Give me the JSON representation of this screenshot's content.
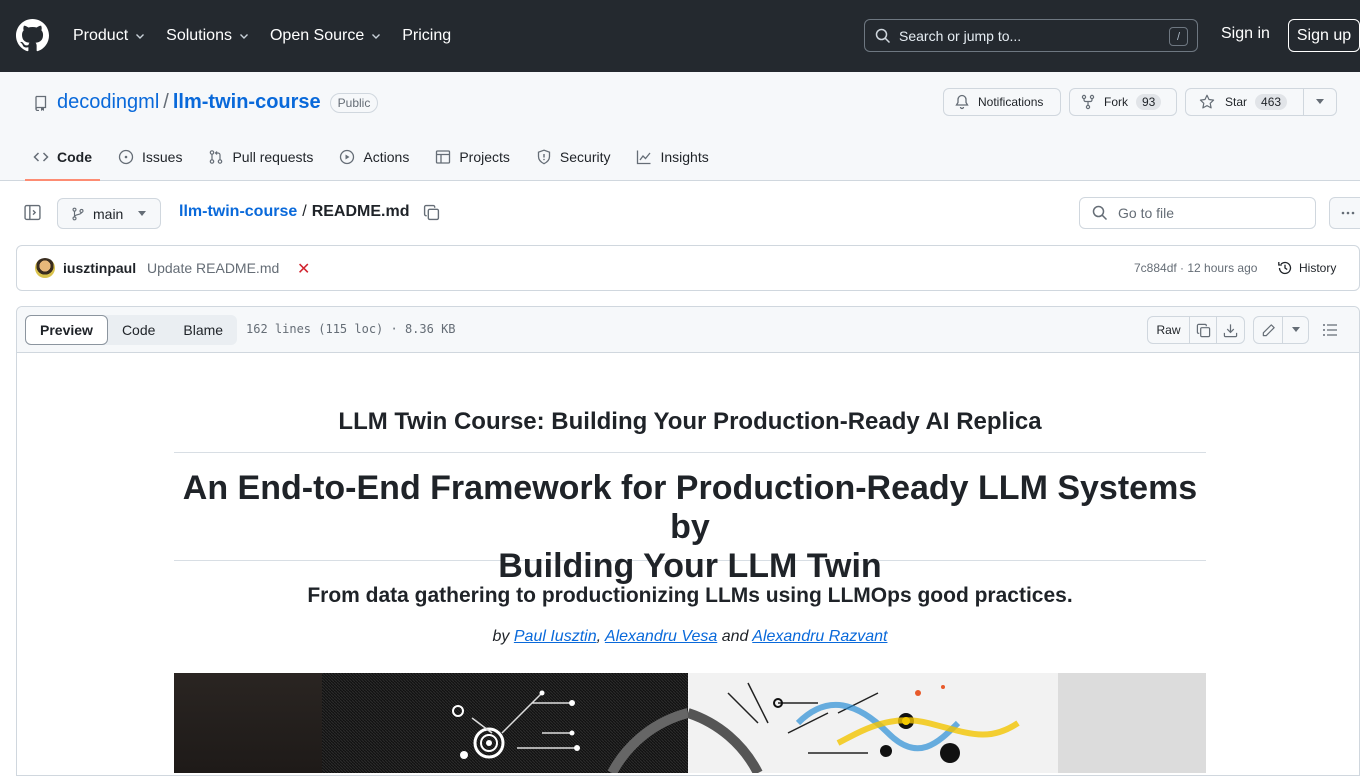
{
  "header": {
    "nav": [
      {
        "label": "Product",
        "dropdown": true
      },
      {
        "label": "Solutions",
        "dropdown": true
      },
      {
        "label": "Open Source",
        "dropdown": true
      },
      {
        "label": "Pricing",
        "dropdown": false
      }
    ],
    "search_placeholder": "Search or jump to...",
    "search_shortcut": "/",
    "sign_in": "Sign in",
    "sign_up": "Sign up"
  },
  "repo": {
    "owner": "decodingml",
    "separator": "/",
    "name": "llm-twin-course",
    "visibility": "Public",
    "notifications_label": "Notifications",
    "fork_label": "Fork",
    "fork_count": "93",
    "star_label": "Star",
    "star_count": "463",
    "tabs": [
      {
        "label": "Code",
        "icon": "code-icon",
        "active": true
      },
      {
        "label": "Issues",
        "icon": "issue-icon"
      },
      {
        "label": "Pull requests",
        "icon": "pull-request-icon"
      },
      {
        "label": "Actions",
        "icon": "play-icon"
      },
      {
        "label": "Projects",
        "icon": "table-icon"
      },
      {
        "label": "Security",
        "icon": "shield-icon"
      },
      {
        "label": "Insights",
        "icon": "graph-icon"
      }
    ]
  },
  "filebar": {
    "branch": "main",
    "breadcrumb_repo": "llm-twin-course",
    "breadcrumb_sep": "/",
    "file_name": "README.md",
    "go_to_file_placeholder": "Go to file"
  },
  "commit": {
    "author": "iusztinpaul",
    "message": "Update README.md",
    "status": "✕",
    "sha": "7c884df",
    "meta_sep": " · ",
    "time": "12 hours ago",
    "history_label": "History"
  },
  "viewer": {
    "tabs": [
      {
        "label": "Preview",
        "active": true
      },
      {
        "label": "Code"
      },
      {
        "label": "Blame"
      }
    ],
    "file_info": "162 lines (115 loc) · 8.36 KB",
    "raw_label": "Raw"
  },
  "readme": {
    "h3": "LLM Twin Course: Building Your Production-Ready AI Replica",
    "h1_line1": "An End-to-End Framework for Production-Ready LLM Systems by",
    "h1_line2": "Building Your LLM Twin",
    "h4": "From data gathering to productionizing LLMs using LLMOps good practices.",
    "by_prefix": "by ",
    "authors": [
      "Paul Iusztin",
      "Alexandru Vesa",
      "Alexandru Razvant"
    ],
    "author_sep": ", ",
    "and": " and ",
    "hero_alt": "LLM Twin course banner illustration"
  },
  "colors": {
    "header_bg": "#24292f",
    "link": "#0969da",
    "active_tab_underline": "#fd8c73",
    "error": "#d1242f"
  }
}
